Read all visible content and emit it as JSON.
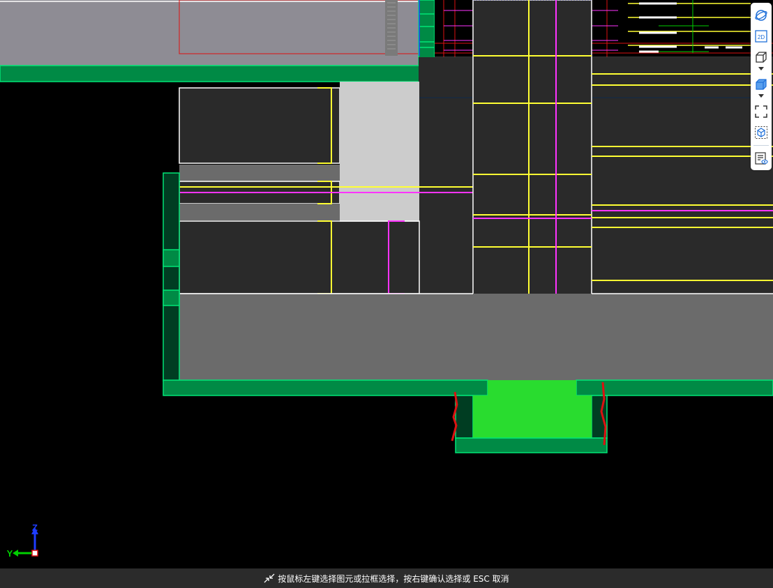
{
  "viewport": {
    "background": "#000000",
    "panel_fill": "#2a2a2a",
    "outline_green": "#00e676",
    "slab_green": "#008a45",
    "dark_green": "#003d22",
    "bright_green": "#29dc2f",
    "gray_light": "#cccccc",
    "gray_mid": "#6b6b6b",
    "gray_top": "#8e8c94",
    "yellow": "#ffff33",
    "magenta": "#ff33ff",
    "red": "#dd1111"
  },
  "view_toolbar": {
    "items": [
      {
        "name": "orbit-icon",
        "label": ""
      },
      {
        "name": "2d-view-icon",
        "label": "2D"
      },
      {
        "name": "box-view-icon",
        "label": ""
      },
      {
        "name": "solid-box-icon",
        "label": ""
      },
      {
        "name": "fit-view-icon",
        "label": ""
      },
      {
        "name": "isolate-box-icon",
        "label": ""
      },
      {
        "name": "layer-visibility-icon",
        "label": ""
      }
    ],
    "accent": "#1e6fd9"
  },
  "axis_indicator": {
    "z_label": "Z",
    "y_label": "Y",
    "z_color": "#1e3cff",
    "y_color": "#00d000"
  },
  "status_bar": {
    "icon": "cursor-select-icon",
    "text": "按鼠标左键选择图元或拉框选择，按右键确认选择或 ESC 取消"
  }
}
